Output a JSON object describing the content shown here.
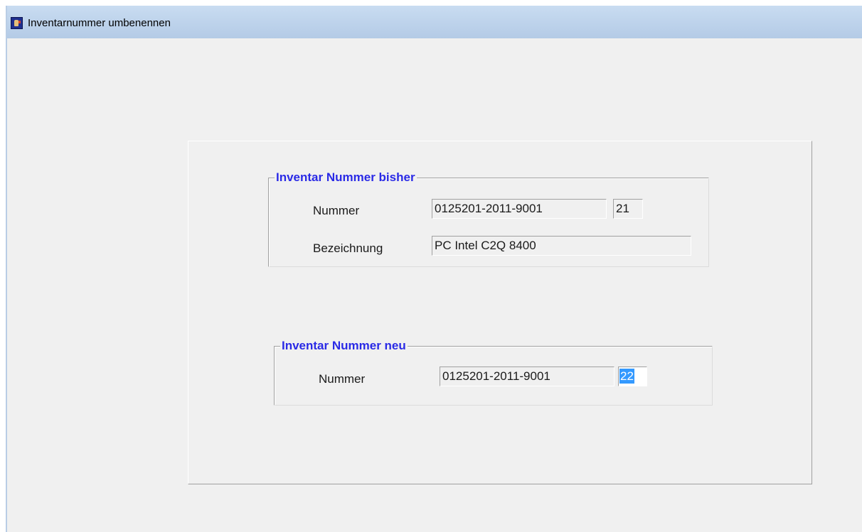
{
  "window": {
    "title": "Inventarnummer umbenennen",
    "app_icon": "inventory-app-icon"
  },
  "old_group": {
    "legend": "Inventar Nummer bisher",
    "nummer_label": "Nummer",
    "nummer_value": "0125201-2011-9001",
    "nummer_suffix": "21",
    "bezeichnung_label": "Bezeichnung",
    "bezeichnung_value": "PC Intel C2Q 8400"
  },
  "new_group": {
    "legend": "Inventar Nummer neu",
    "nummer_label": "Nummer",
    "nummer_value": "0125201-2011-9001",
    "nummer_suffix": "22"
  },
  "colors": {
    "legend_text": "#2a2ae6",
    "selection": "#3399ff",
    "titlebar": "#bfd4ec",
    "background": "#f0f0f0"
  }
}
